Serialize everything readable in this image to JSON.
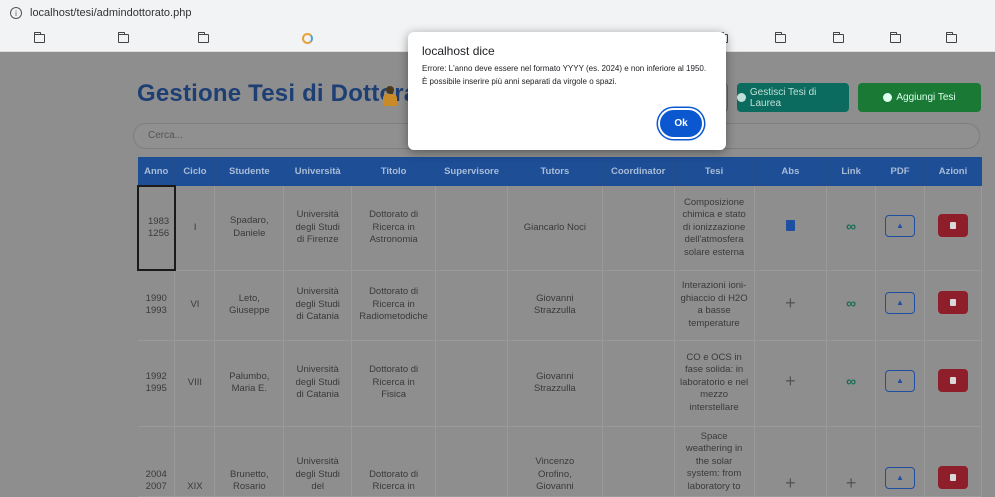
{
  "browser": {
    "url": "localhost/tesi/admindottorato.php",
    "info_icon": "info-icon"
  },
  "header": {
    "title": "Gestione Tesi di Dottorato",
    "manage_button": "Gestisci Tesi di Laurea",
    "add_button": "Aggiungi Tesi"
  },
  "search": {
    "placeholder": "Cerca..."
  },
  "table": {
    "columns": [
      "Anno",
      "Ciclo",
      "Studente",
      "Università",
      "Titolo",
      "Supervisore",
      "Tutors",
      "Coordinator",
      "Tesi",
      "Abs",
      "Link",
      "PDF",
      "Azioni"
    ],
    "rows": [
      {
        "anno": "1983\n1256",
        "ciclo": "I",
        "studente": "Spadaro,\nDaniele",
        "universita": "Università\ndegli Studi\ndi Firenze",
        "titolo": "Dottorato di\nRicerca in\nAstronomia",
        "supervisore": "",
        "tutors": "Giancarlo Noci",
        "coordinator": "",
        "tesi": "Composizione\nchimica e stato\ndi ionizzazione\ndell'atmosfera\nsolare esterna",
        "abs": "document-icon",
        "link": "link-icon"
      },
      {
        "anno": "1990\n1993",
        "ciclo": "VI",
        "studente": "Leto,\nGiuseppe",
        "universita": "Università\ndegli Studi\ndi Catania",
        "titolo": "Dottorato di\nRicerca in\nRadiometodiche",
        "supervisore": "",
        "tutors": "Giovanni\nStrazzulla",
        "coordinator": "",
        "tesi": "Interazioni ioni-\nghiaccio di H2O\na basse\ntemperature",
        "abs": "+",
        "link": "link-icon"
      },
      {
        "anno": "1992\n1995",
        "ciclo": "VIII",
        "studente": "Palumbo,\nMaria E.",
        "universita": "Università\ndegli Studi\ndi Catania",
        "titolo": "Dottorato di\nRicerca in\nFisica",
        "supervisore": "",
        "tutors": "Giovanni\nStrazzulla",
        "coordinator": "",
        "tesi": "CO e OCS in\nfase solida: in\nlaboratorio e nel\nmezzo\ninterstellare",
        "abs": "+",
        "link": "link-icon"
      },
      {
        "anno": "2004\n2007",
        "ciclo": "XIX",
        "studente": "Brunetto,\nRosario",
        "universita": "Università\ndegli Studi\ndel",
        "titolo": "Dottorato di\nRicerca in",
        "supervisore": "",
        "tutors": "Vincenzo\nOrofino,\nGiovanni",
        "coordinator": "",
        "tesi": "Space\nweathering in\nthe solar\nsystem: from\nlaboratory to",
        "abs": "+",
        "link": "+"
      }
    ]
  },
  "dialog": {
    "title": "localhost dice",
    "message": "Errore: L'anno deve essere nel formato YYYY (es. 2024) e non inferiore al 1950. È possibile inserire più anni separati da virgole o spazi.",
    "ok_label": "Ok"
  }
}
